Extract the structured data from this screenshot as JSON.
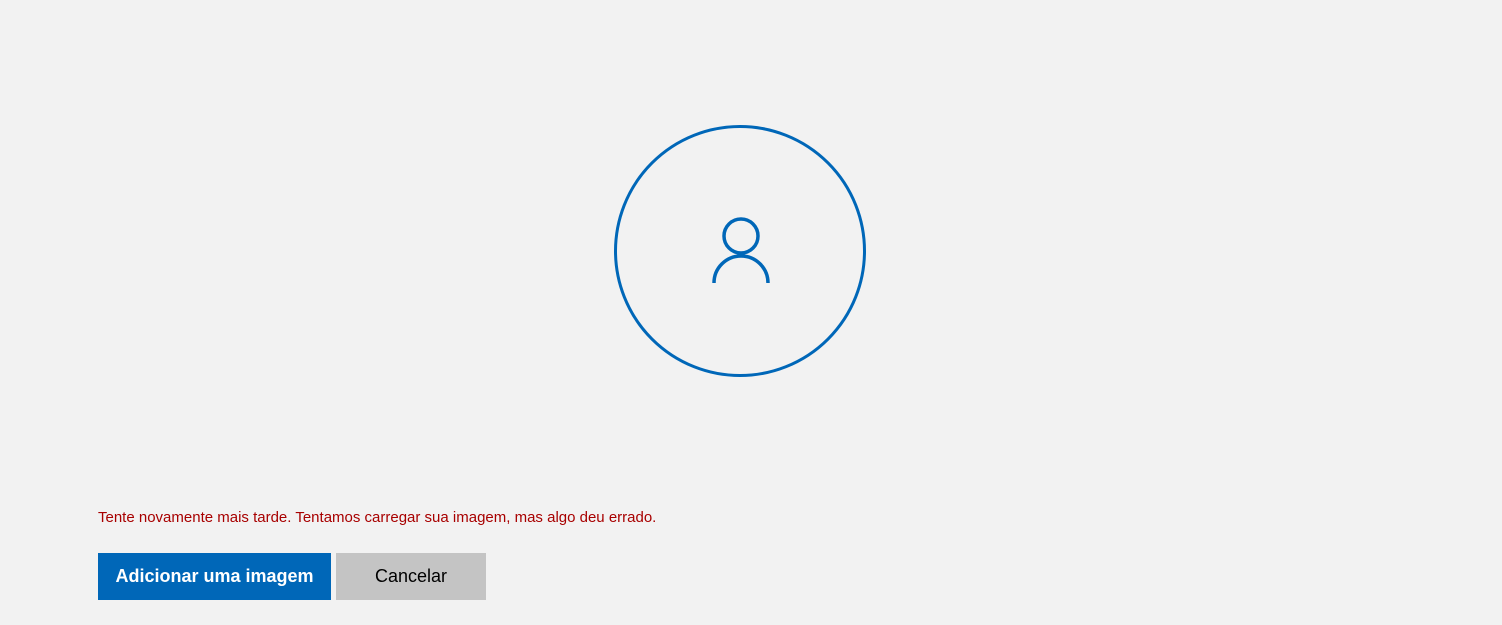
{
  "avatar": {
    "icon": "person-icon",
    "color": "#0067b8"
  },
  "error": {
    "message": "Tente novamente mais tarde. Tentamos carregar sua imagem, mas algo deu errado.",
    "color": "#a80000"
  },
  "actions": {
    "primary_label": "Adicionar uma imagem",
    "secondary_label": "Cancelar",
    "primary_color": "#0067b8",
    "secondary_color": "#c4c4c4"
  }
}
